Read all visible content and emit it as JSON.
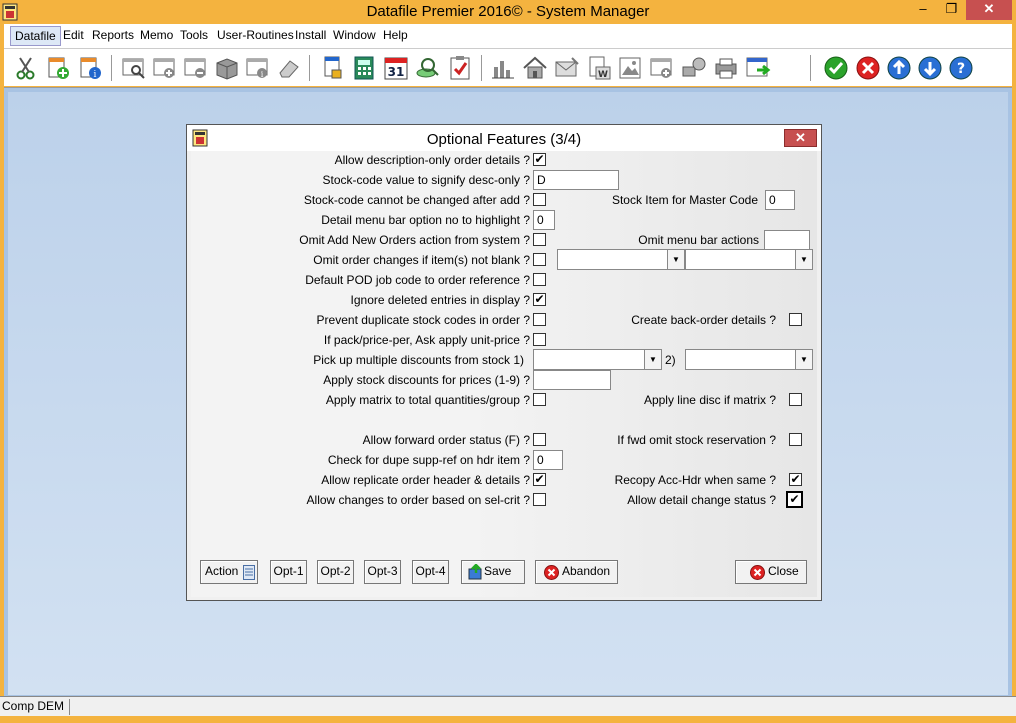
{
  "window": {
    "title": "Datafile  Premier 2016© - System Manager",
    "min_glyph": "–",
    "max_glyph": "❐",
    "close_glyph": "✕"
  },
  "menu": [
    "Datafile",
    "Edit",
    "Reports",
    "Memo",
    "Tools",
    "User-Routines",
    "Install",
    "Window",
    "Help"
  ],
  "status": {
    "company": "Comp DEM"
  },
  "dialog": {
    "title": "Optional Features (3/4)",
    "close_glyph": "✕",
    "fields": {
      "desc_only": {
        "label": "Allow description-only order details ?",
        "checked": "✔"
      },
      "stock_code_value": {
        "label": "Stock-code value to signify desc-only ?",
        "value": "D"
      },
      "cannot_change": {
        "label": "Stock-code cannot be changed after add ?",
        "checked": ""
      },
      "stock_item_master": {
        "label": "Stock Item for Master Code",
        "value": "0"
      },
      "menu_option": {
        "label": "Detail menu bar option no to highlight ?",
        "value": "0"
      },
      "omit_add": {
        "label": "Omit Add New Orders action from system ?",
        "checked": ""
      },
      "omit_menu_actions": {
        "label": "Omit menu bar actions",
        "value": ""
      },
      "omit_changes": {
        "label": "Omit order changes if item(s) not blank ?",
        "checked": ""
      },
      "default_pod": {
        "label": "Default POD job code to order reference ?",
        "checked": ""
      },
      "ignore_deleted": {
        "label": "Ignore deleted entries in display ?",
        "checked": "✔"
      },
      "prevent_dup": {
        "label": "Prevent duplicate stock codes in order ?",
        "checked": ""
      },
      "back_order": {
        "label": "Create back-order details ?",
        "checked": ""
      },
      "pack_price": {
        "label": "If pack/price-per, Ask apply unit-price ?",
        "checked": ""
      },
      "multi_disc": {
        "label": "Pick up multiple discounts from stock  1)",
        "label2": "2)"
      },
      "apply_disc": {
        "label": "Apply stock discounts for prices (1-9) ?",
        "value": ""
      },
      "apply_matrix": {
        "label": "Apply matrix to total quantities/group ?",
        "checked": ""
      },
      "line_disc": {
        "label": "Apply line disc if matrix ?",
        "checked": ""
      },
      "forward_status": {
        "label": "Allow forward order status (F) ?",
        "checked": ""
      },
      "omit_reservation": {
        "label": "If fwd omit stock reservation ?",
        "checked": ""
      },
      "dupe_supp": {
        "label": "Check for dupe supp-ref on hdr item ?",
        "value": "0"
      },
      "replicate": {
        "label": "Allow replicate order header & details ?",
        "checked": "✔"
      },
      "recopy": {
        "label": "Recopy Acc-Hdr when same ?",
        "checked": "✔"
      },
      "sel_crit": {
        "label": "Allow changes to order based on sel-crit ?",
        "checked": ""
      },
      "detail_status": {
        "label": "Allow detail change status ?",
        "checked": "✔"
      }
    },
    "dropdown_arrow": "▼",
    "buttons": {
      "action": "Action",
      "opt1": "Opt-1",
      "opt2": "Opt-2",
      "opt3": "Opt-3",
      "opt4": "Opt-4",
      "save": "Save",
      "abandon": "Abandon",
      "close": "Close"
    }
  }
}
